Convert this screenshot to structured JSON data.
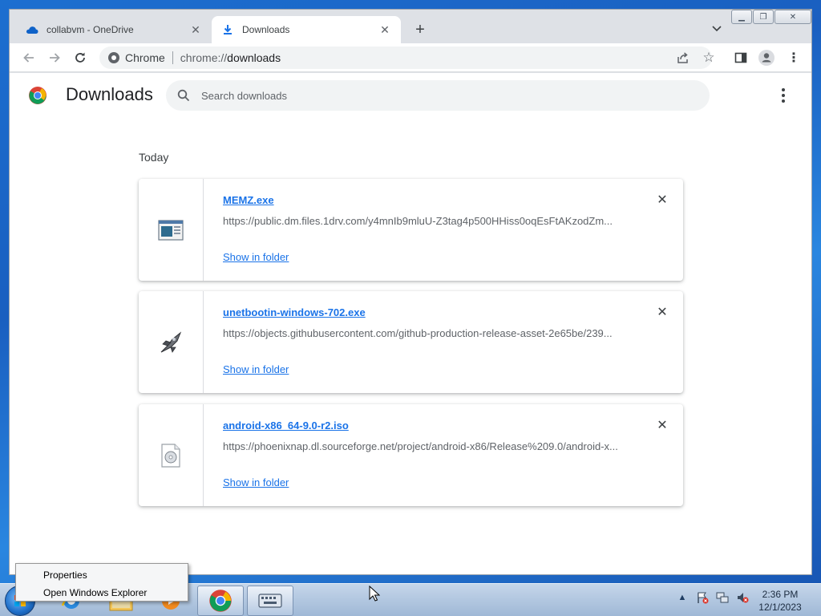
{
  "browser": {
    "tabs": [
      {
        "title": "collabvm - OneDrive",
        "icon": "onedrive-cloud-icon",
        "active": false
      },
      {
        "title": "Downloads",
        "icon": "download-arrow-icon",
        "active": true
      }
    ],
    "new_tab": "+",
    "window_buttons": [
      "minimize",
      "maximize",
      "close"
    ],
    "address_bar": {
      "site_chip": "Chrome",
      "url_scheme": "chrome://",
      "url_host": "downloads"
    }
  },
  "downloads_page": {
    "title": "Downloads",
    "search_placeholder": "Search downloads",
    "date_group": "Today",
    "items": [
      {
        "filename": "MEMZ.exe",
        "url": "https://public.dm.files.1drv.com/y4mnIb9mluU-Z3tag4p500HHiss0oqEsFtAKzodZm...",
        "action": "Show in folder",
        "remove": "✕",
        "icon": "exe-window-icon"
      },
      {
        "filename": "unetbootin-windows-702.exe",
        "url": "https://objects.githubusercontent.com/github-production-release-asset-2e65be/239...",
        "action": "Show in folder",
        "remove": "✕",
        "icon": "unetbootin-rocket-icon"
      },
      {
        "filename": "android-x86_64-9.0-r2.iso",
        "url": "https://phoenixnap.dl.sourceforge.net/project/android-x86/Release%209.0/android-x...",
        "action": "Show in folder",
        "remove": "✕",
        "icon": "iso-disc-file-icon"
      }
    ]
  },
  "context_menu": {
    "items": [
      "Properties",
      "Open Windows Explorer"
    ]
  },
  "taskbar": {
    "clock_time": "2:36 PM",
    "clock_date": "12/1/2023",
    "tray_expand": "▲"
  },
  "colors": {
    "link": "#1a73e8",
    "desktop": "#1c6fd0",
    "tabstrip": "#dee1e6"
  }
}
